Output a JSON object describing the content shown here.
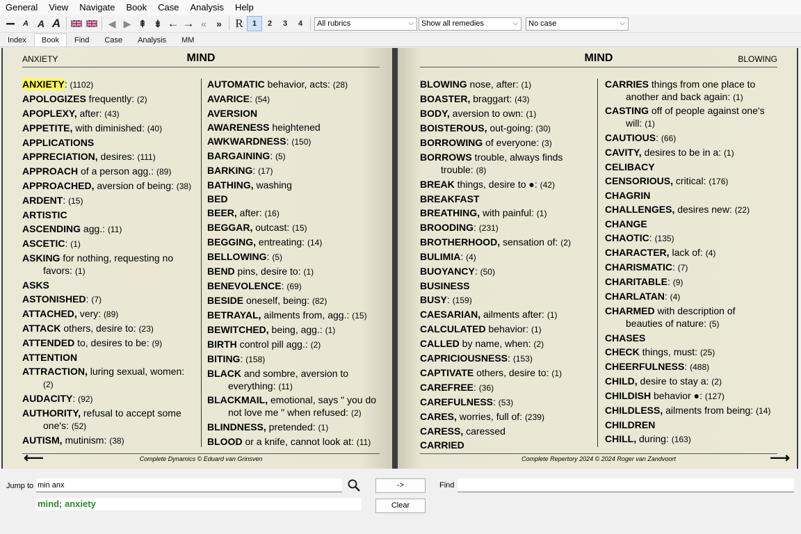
{
  "menu": [
    "General",
    "View",
    "Navigate",
    "Book",
    "Case",
    "Analysis",
    "Help"
  ],
  "toolbar": {
    "icons": [
      "minus-icon",
      "font-small-icon",
      "font-medium-icon",
      "font-large-icon",
      "flag-uk-icon",
      "flag-uk-2-icon",
      "play-back-icon",
      "play-forward-icon",
      "chapter-up-icon",
      "chapter-down-icon",
      "arrow-left-icon",
      "arrow-right-icon",
      "history-back-icon",
      "history-forward-icon",
      "repertory-r-icon"
    ],
    "levels": [
      "1",
      "2",
      "3",
      "4"
    ],
    "rubrics_select": "All rubrics",
    "remedies_select": "Show all remedies",
    "case_select": "No case"
  },
  "tabs": [
    "Index",
    "Book",
    "Find",
    "Case",
    "Analysis",
    "MM"
  ],
  "left_page": {
    "section": "ANXIETY",
    "chapter": "MIND",
    "footer": "Complete Dynamics © Eduard van Grinsven",
    "col1": [
      {
        "kw": "ANXIETY",
        "rest": ":",
        "count": "(1102)"
      },
      {
        "kw": "APOLOGIZES",
        "rest": " frequently:",
        "count": "(2)"
      },
      {
        "kw": "APOPLEXY,",
        "rest": " after:",
        "count": "(43)"
      },
      {
        "kw": "APPETITE,",
        "rest": " with diminished:",
        "count": "(40)"
      },
      {
        "kw": "APPLICATIONS",
        "rest": "",
        "count": ""
      },
      {
        "kw": "APPRECIATION,",
        "rest": " desires:",
        "count": "(111)"
      },
      {
        "kw": "APPROACH",
        "rest": " of a person agg.:",
        "count": "(89)"
      },
      {
        "kw": "APPROACHED,",
        "rest": " aversion of being:",
        "count": "(38)",
        "wrap": true
      },
      {
        "kw": "ARDENT",
        "rest": ":",
        "count": "(15)"
      },
      {
        "kw": "ARTISTIC",
        "rest": "",
        "count": ""
      },
      {
        "kw": "ASCENDING",
        "rest": " agg.:",
        "count": "(11)"
      },
      {
        "kw": "ASCETIC",
        "rest": ":",
        "count": "(1)"
      },
      {
        "kw": "ASKING",
        "rest": " for nothing, requesting no favors:",
        "count": "(1)",
        "wrap": true
      },
      {
        "kw": "ASKS",
        "rest": "",
        "count": ""
      },
      {
        "kw": "ASTONISHED",
        "rest": ":",
        "count": "(7)"
      },
      {
        "kw": "ATTACHED,",
        "rest": " very:",
        "count": "(89)"
      },
      {
        "kw": "ATTACK",
        "rest": " others, desire to:",
        "count": "(23)"
      },
      {
        "kw": "ATTENDED",
        "rest": " to, desires to be:",
        "count": "(9)"
      },
      {
        "kw": "ATTENTION",
        "rest": "",
        "count": ""
      },
      {
        "kw": "ATTRACTION,",
        "rest": " luring sexual, women:",
        "count": "(2)",
        "wrap": true
      },
      {
        "kw": "AUDACITY",
        "rest": ":",
        "count": "(92)"
      },
      {
        "kw": "AUTHORITY,",
        "rest": " refusal to accept some one's:",
        "count": "(52)",
        "wrap": true
      },
      {
        "kw": "AUTISM,",
        "rest": " mutinism:",
        "count": "(38)"
      }
    ],
    "col2": [
      {
        "kw": "AUTOMATIC",
        "rest": " behavior, acts:",
        "count": "(28)"
      },
      {
        "kw": "AVARICE",
        "rest": ":",
        "count": "(54)"
      },
      {
        "kw": "AVERSION",
        "rest": "",
        "count": ""
      },
      {
        "kw": "AWARENESS",
        "rest": " heightened",
        "count": ""
      },
      {
        "kw": "AWKWARDNESS",
        "rest": ":",
        "count": "(150)"
      },
      {
        "kw": "BARGAINING",
        "rest": ":",
        "count": "(5)"
      },
      {
        "kw": "BARKING",
        "rest": ":",
        "count": "(17)"
      },
      {
        "kw": "BATHING,",
        "rest": " washing",
        "count": ""
      },
      {
        "kw": "BED",
        "rest": "",
        "count": ""
      },
      {
        "kw": "BEER,",
        "rest": " after:",
        "count": "(16)"
      },
      {
        "kw": "BEGGAR,",
        "rest": " outcast:",
        "count": "(15)"
      },
      {
        "kw": "BEGGING,",
        "rest": " entreating:",
        "count": "(14)"
      },
      {
        "kw": "BELLOWING",
        "rest": ":",
        "count": "(5)"
      },
      {
        "kw": "BEND",
        "rest": " pins, desire to:",
        "count": "(1)"
      },
      {
        "kw": "BENEVOLENCE",
        "rest": ":",
        "count": "(69)"
      },
      {
        "kw": "BESIDE",
        "rest": " oneself, being:",
        "count": "(82)"
      },
      {
        "kw": "BETRAYAL,",
        "rest": " ailments from, agg.:",
        "count": "(15)"
      },
      {
        "kw": "BEWITCHED,",
        "rest": " being, agg.:",
        "count": "(1)"
      },
      {
        "kw": "BIRTH",
        "rest": " control pill agg.:",
        "count": "(2)"
      },
      {
        "kw": "BITING",
        "rest": ":",
        "count": "(158)"
      },
      {
        "kw": "BLACK",
        "rest": " and sombre, aversion to everything:",
        "count": "(11)",
        "wrap": true
      },
      {
        "kw": "BLACKMAIL,",
        "rest": " emotional, says \" you do not love me \" when refused:",
        "count": "(2)",
        "wrap": true
      },
      {
        "kw": "BLINDNESS,",
        "rest": " pretended:",
        "count": "(1)"
      },
      {
        "kw": "BLOOD",
        "rest": " or a knife, cannot look at:",
        "count": "(11)"
      }
    ]
  },
  "right_page": {
    "section": "BLOWING",
    "chapter": "MIND",
    "footer": "Complete Repertory 2024 © 2024 Roger van Zandvoort",
    "col1": [
      {
        "kw": "BLOWING",
        "rest": " nose, after:",
        "count": "(1)"
      },
      {
        "kw": "BOASTER,",
        "rest": " braggart:",
        "count": "(43)"
      },
      {
        "kw": "BODY,",
        "rest": " aversion to own:",
        "count": "(1)"
      },
      {
        "kw": "BOISTEROUS,",
        "rest": " out-going:",
        "count": "(30)"
      },
      {
        "kw": "BORROWING",
        "rest": " of everyone:",
        "count": "(3)"
      },
      {
        "kw": "BORROWS",
        "rest": " trouble, always finds trouble:",
        "count": "(8)",
        "wrap": true
      },
      {
        "kw": "BREAK",
        "rest": " things, desire to ●:",
        "count": "(42)"
      },
      {
        "kw": "BREAKFAST",
        "rest": "",
        "count": ""
      },
      {
        "kw": "BREATHING,",
        "rest": " with painful:",
        "count": "(1)"
      },
      {
        "kw": "BROODING",
        "rest": ":",
        "count": "(231)"
      },
      {
        "kw": "BROTHERHOOD,",
        "rest": " sensation of:",
        "count": "(2)"
      },
      {
        "kw": "BULIMIA",
        "rest": ":",
        "count": "(4)"
      },
      {
        "kw": "BUOYANCY",
        "rest": ":",
        "count": "(50)"
      },
      {
        "kw": "BUSINESS",
        "rest": "",
        "count": ""
      },
      {
        "kw": "BUSY",
        "rest": ":",
        "count": "(159)"
      },
      {
        "kw": "CAESARIAN,",
        "rest": " ailments after:",
        "count": "(1)"
      },
      {
        "kw": "CALCULATED",
        "rest": " behavior:",
        "count": "(1)"
      },
      {
        "kw": "CALLED",
        "rest": " by name, when:",
        "count": "(2)"
      },
      {
        "kw": "CAPRICIOUSNESS",
        "rest": ":",
        "count": "(153)"
      },
      {
        "kw": "CAPTIVATE",
        "rest": " others, desire to:",
        "count": "(1)"
      },
      {
        "kw": "CAREFREE",
        "rest": ":",
        "count": "(36)"
      },
      {
        "kw": "CAREFULNESS",
        "rest": ":",
        "count": "(53)"
      },
      {
        "kw": "CARES,",
        "rest": " worries, full of:",
        "count": "(239)"
      },
      {
        "kw": "CARESS,",
        "rest": " caressed",
        "count": ""
      },
      {
        "kw": "CARRIED",
        "rest": "",
        "count": ""
      }
    ],
    "col2": [
      {
        "kw": "CARRIES",
        "rest": " things from one place to another and back again:",
        "count": "(1)",
        "wrap": true
      },
      {
        "kw": "CASTING",
        "rest": " off of people against one's will:",
        "count": "(1)",
        "wrap": true
      },
      {
        "kw": "CAUTIOUS",
        "rest": ":",
        "count": "(66)"
      },
      {
        "kw": "CAVITY,",
        "rest": " desires to be in a:",
        "count": "(1)"
      },
      {
        "kw": "CELIBACY",
        "rest": "",
        "count": ""
      },
      {
        "kw": "CENSORIOUS,",
        "rest": " critical:",
        "count": "(176)"
      },
      {
        "kw": "CHAGRIN",
        "rest": "",
        "count": ""
      },
      {
        "kw": "CHALLENGES,",
        "rest": " desires new:",
        "count": "(22)"
      },
      {
        "kw": "CHANGE",
        "rest": "",
        "count": ""
      },
      {
        "kw": "CHAOTIC",
        "rest": ":",
        "count": "(135)"
      },
      {
        "kw": "CHARACTER,",
        "rest": " lack of:",
        "count": "(4)"
      },
      {
        "kw": "CHARISMATIC",
        "rest": ":",
        "count": "(7)"
      },
      {
        "kw": "CHARITABLE",
        "rest": ":",
        "count": "(9)"
      },
      {
        "kw": "CHARLATAN",
        "rest": ":",
        "count": "(4)"
      },
      {
        "kw": "CHARMED",
        "rest": " with description of beauties of nature:",
        "count": "(5)",
        "wrap": true
      },
      {
        "kw": "CHASES",
        "rest": "",
        "count": ""
      },
      {
        "kw": "CHECK",
        "rest": " things, must:",
        "count": "(25)"
      },
      {
        "kw": "CHEERFULNESS",
        "rest": ":",
        "count": "(488)"
      },
      {
        "kw": "CHILD,",
        "rest": " desire to stay a:",
        "count": "(2)"
      },
      {
        "kw": "CHILDISH",
        "rest": " behavior ●:",
        "count": "(127)"
      },
      {
        "kw": "CHILDLESS,",
        "rest": " ailments from being:",
        "count": "(14)",
        "wrap": true
      },
      {
        "kw": "CHILDREN",
        "rest": "",
        "count": ""
      },
      {
        "kw": "CHILL,",
        "rest": " during:",
        "count": "(163)"
      }
    ]
  },
  "bottom": {
    "jump_label": "Jump to",
    "jump_value": "min anx",
    "go_button": "->",
    "clear_button": "Clear",
    "find_label": "Find",
    "find_value": "",
    "result": "mind; anxiety"
  }
}
